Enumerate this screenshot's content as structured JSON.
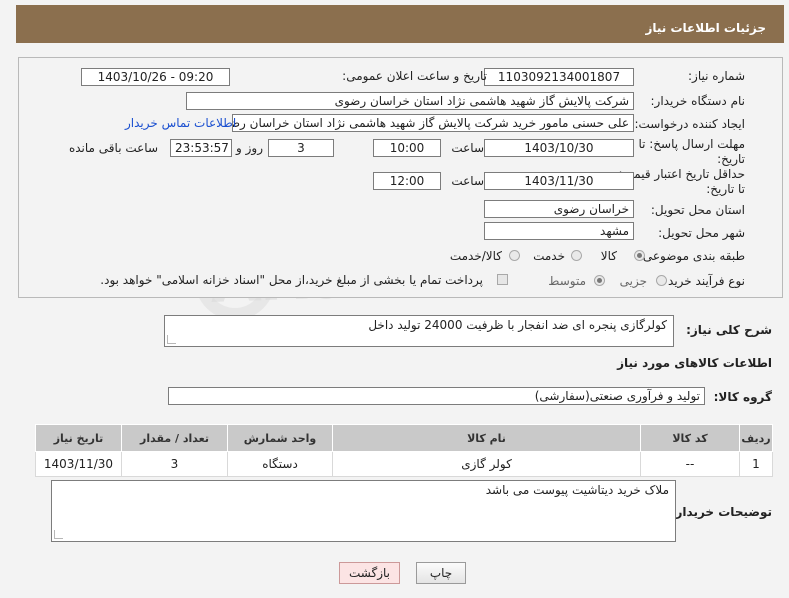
{
  "header": {
    "title": "جزئیات اطلاعات نیاز"
  },
  "form": {
    "need_number_label": "شماره نیاز:",
    "need_number": "1103092134001807",
    "announce_label": "تاریخ و ساعت اعلان عمومی:",
    "announce_value": "1403/10/26 - 09:20",
    "buyer_org_label": "نام دستگاه خریدار:",
    "buyer_org": "شرکت پالایش گاز شهید هاشمی نژاد   استان خراسان رضوی",
    "requester_label": "ایجاد کننده درخواست:",
    "requester": "علی حسنی مامور خرید شرکت پالایش گاز شهید هاشمی نژاد   استان خراسان رضوی",
    "contact_link": "اطلاعات تماس خریدار",
    "deadline_label": "مهلت ارسال پاسخ: تا تاریخ:",
    "deadline_date": "1403/10/30",
    "time_label": "ساعت",
    "deadline_time": "10:00",
    "days_value": "3",
    "days_label": "روز و",
    "remaining_time": "23:53:57",
    "remaining_label": "ساعت باقی مانده",
    "validity_label": "حداقل تاریخ اعتبار قیمت: تا تاریخ:",
    "validity_date": "1403/11/30",
    "validity_time": "12:00",
    "province_label": "استان محل تحویل:",
    "province": "خراسان رضوی",
    "city_label": "شهر محل تحویل:",
    "city": "مشهد",
    "category_label": "طبقه بندی موضوعی:",
    "category_options": [
      "کالا",
      "خدمت",
      "کالا/خدمت"
    ],
    "category_selected": "کالا",
    "process_label": "نوع فرآیند خرید :",
    "process_options": [
      "جزیی",
      "متوسط"
    ],
    "process_selected": "متوسط",
    "payment_note": "پرداخت تمام یا بخشی از مبلغ خرید،از محل \"اسناد خزانه اسلامی\" خواهد بود."
  },
  "description": {
    "label": "شرح کلی نیاز:",
    "value": "کولرگازی پنجره ای ضد انفجار با ظرفیت 24000 تولید داخل"
  },
  "goods_info_title": "اطلاعات کالاهای مورد نیاز",
  "goods_group": {
    "label": "گروه کالا:",
    "value": "تولید و فرآوری صنعتی(سفارشی)"
  },
  "table": {
    "headers": [
      "ردیف",
      "کد کالا",
      "نام کالا",
      "واحد شمارش",
      "تعداد / مقدار",
      "تاریخ نیاز"
    ],
    "rows": [
      [
        "1",
        "--",
        "کولر گازی",
        "دستگاه",
        "3",
        "1403/11/30"
      ]
    ]
  },
  "buyer_notes": {
    "label": "توضیحات خریدار:",
    "value": "ملاک خرید دیتاشیت پیوست می باشد"
  },
  "buttons": {
    "print": "چاپ",
    "back": "بازگشت"
  },
  "watermark": "AriaTender.net"
}
